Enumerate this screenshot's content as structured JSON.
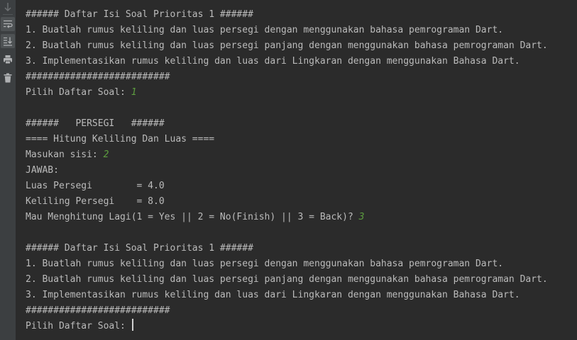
{
  "toolbar": {
    "icons": [
      "down-arrow-icon",
      "soft-wrap-icon",
      "scroll-to-end-icon",
      "print-icon",
      "trash-icon"
    ],
    "colors": {
      "background": "#3c3f41",
      "icon": "#afb1b3",
      "active": "#4e5254"
    }
  },
  "console": {
    "colors": {
      "text": "#bbbbbb",
      "input": "#5d9e3f",
      "background": "#2b2b2b"
    },
    "lines": [
      {
        "text": "###### Daftar Isi Soal Prioritas 1 ######",
        "input": ""
      },
      {
        "text": "1. Buatlah rumus keliling dan luas persegi dengan menggunakan bahasa pemrograman Dart.",
        "input": ""
      },
      {
        "text": "2. Buatlah rumus keliling dan luas persegi panjang dengan menggunakan bahasa pemrograman Dart.",
        "input": ""
      },
      {
        "text": "3. Implementasikan rumus keliling dan luas dari Lingkaran dengan menggunakan Bahasa Dart.",
        "input": ""
      },
      {
        "text": "##########################",
        "input": ""
      },
      {
        "text": "Pilih Daftar Soal: ",
        "input": "1"
      },
      {
        "text": "",
        "input": ""
      },
      {
        "text": "######   PERSEGI   ######",
        "input": ""
      },
      {
        "text": "==== Hitung Keliling Dan Luas ====",
        "input": ""
      },
      {
        "text": "Masukan sisi: ",
        "input": "2"
      },
      {
        "text": "JAWAB:",
        "input": ""
      },
      {
        "text": "Luas Persegi        = 4.0",
        "input": ""
      },
      {
        "text": "Keliling Persegi    = 8.0",
        "input": ""
      },
      {
        "text": "Mau Menghitung Lagi(1 = Yes || 2 = No(Finish) || 3 = Back)? ",
        "input": "3"
      },
      {
        "text": "",
        "input": ""
      },
      {
        "text": "###### Daftar Isi Soal Prioritas 1 ######",
        "input": ""
      },
      {
        "text": "1. Buatlah rumus keliling dan luas persegi dengan menggunakan bahasa pemrograman Dart.",
        "input": ""
      },
      {
        "text": "2. Buatlah rumus keliling dan luas persegi panjang dengan menggunakan bahasa pemrograman Dart.",
        "input": ""
      },
      {
        "text": "3. Implementasikan rumus keliling dan luas dari Lingkaran dengan menggunakan Bahasa Dart.",
        "input": ""
      },
      {
        "text": "##########################",
        "input": ""
      },
      {
        "text": "Pilih Daftar Soal: ",
        "input": ""
      }
    ]
  }
}
